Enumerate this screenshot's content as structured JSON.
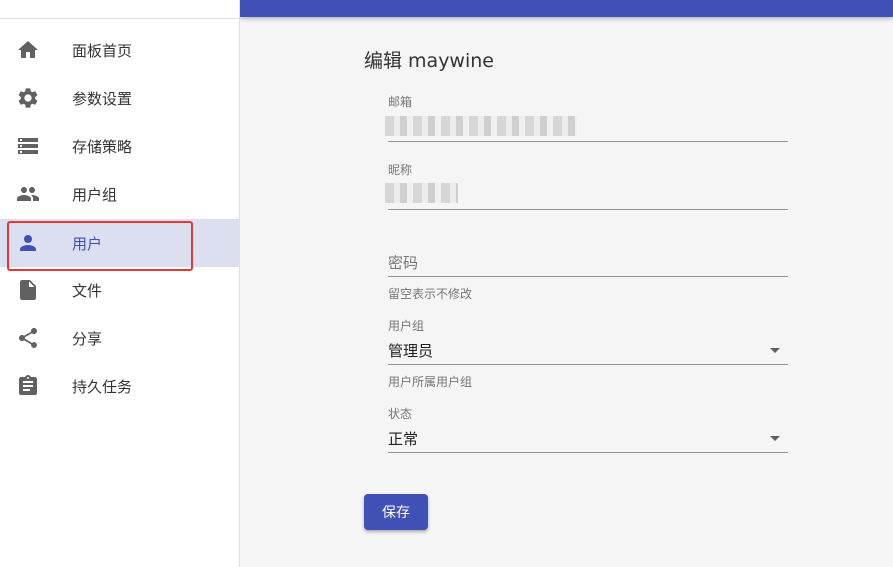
{
  "sidebar": {
    "items": [
      {
        "label": "面板首页",
        "icon": "home-icon"
      },
      {
        "label": "参数设置",
        "icon": "gear-icon"
      },
      {
        "label": "存储策略",
        "icon": "storage-list-icon"
      },
      {
        "label": "用户组",
        "icon": "people-icon"
      },
      {
        "label": "用户",
        "icon": "person-icon",
        "active": true
      },
      {
        "label": "文件",
        "icon": "file-icon"
      },
      {
        "label": "分享",
        "icon": "share-icon"
      },
      {
        "label": "持久任务",
        "icon": "clipboard-icon"
      }
    ]
  },
  "form": {
    "title": "编辑 maywine",
    "email_label": "邮箱",
    "nickname_label": "昵称",
    "password_placeholder": "密码",
    "password_helper": "留空表示不修改",
    "group_label": "用户组",
    "group_value": "管理员",
    "group_helper": "用户所属用户组",
    "status_label": "状态",
    "status_value": "正常",
    "save_label": "保存"
  },
  "colors": {
    "primary": "#3f51b5",
    "highlight_box": "#e53935",
    "active_bg": "#dcdff0"
  }
}
